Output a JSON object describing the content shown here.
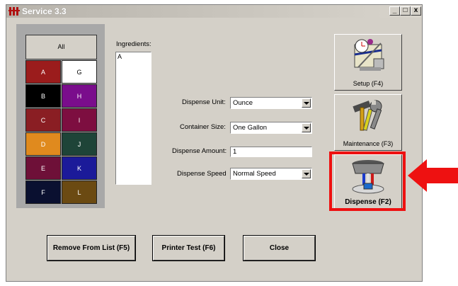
{
  "window": {
    "title": "Service 3.3"
  },
  "title_buttons": {
    "minimize": "_",
    "maximize": "□",
    "close": "x"
  },
  "background_text": [
    "",
    "",
    ""
  ],
  "palette": {
    "all_label": "All",
    "cells": [
      {
        "label": "A",
        "color": "#9b1c1c",
        "text_color": "#ffffff"
      },
      {
        "label": "G",
        "color": "#ffffff",
        "text_color": "#000000"
      },
      {
        "label": "B",
        "color": "#000000",
        "text_color": "#ffffff"
      },
      {
        "label": "H",
        "color": "#7a0d8c",
        "text_color": "#ffffff"
      },
      {
        "label": "C",
        "color": "#8a1e23",
        "text_color": "#ffffff"
      },
      {
        "label": "I",
        "color": "#7d0e40",
        "text_color": "#ffffff"
      },
      {
        "label": "D",
        "color": "#e08a1e",
        "text_color": "#ffffff"
      },
      {
        "label": "J",
        "color": "#1e4438",
        "text_color": "#ffffff"
      },
      {
        "label": "E",
        "color": "#6e1038",
        "text_color": "#ffffff"
      },
      {
        "label": "K",
        "color": "#1b1a99",
        "text_color": "#ffffff"
      },
      {
        "label": "F",
        "color": "#0a1030",
        "text_color": "#ffffff"
      },
      {
        "label": "L",
        "color": "#6b4a12",
        "text_color": "#ffffff"
      }
    ]
  },
  "ingredients": {
    "label": "Ingredients:",
    "items": [
      "A"
    ]
  },
  "form": {
    "dispense_unit": {
      "label": "Dispense Unit:",
      "value": "Ounce"
    },
    "container_size": {
      "label": "Container Size:",
      "value": "One Gallon"
    },
    "dispense_amount": {
      "label": "Dispense Amount:",
      "value": "1"
    },
    "dispense_speed": {
      "label": "Dispense Speed",
      "value": "Normal Speed"
    }
  },
  "side_buttons": {
    "setup": "Setup (F4)",
    "maintenance": "Maintenance (F3)",
    "dispense": "Dispense (F2)"
  },
  "bottom_buttons": {
    "remove": "Remove From List (F5)",
    "printer_test": "Printer Test (F6)",
    "close": "Close"
  },
  "annotation": {
    "highlight_color": "#ee1111"
  }
}
